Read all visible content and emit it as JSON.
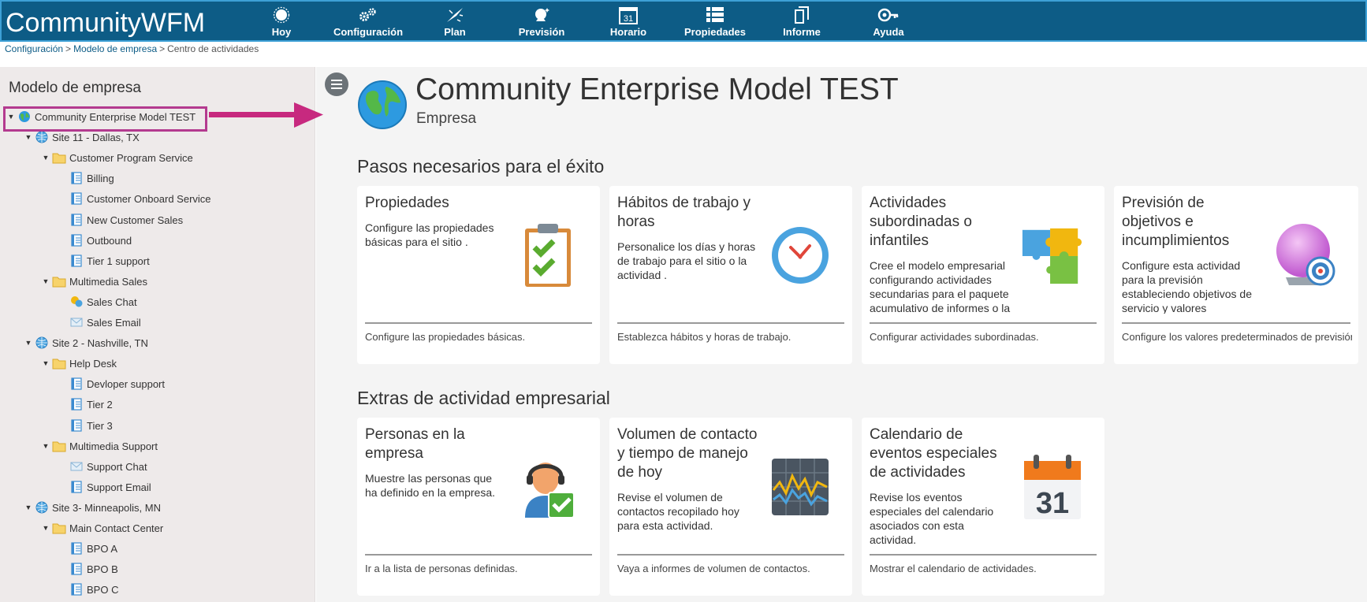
{
  "app": {
    "brand": "CommunityWFM"
  },
  "nav": [
    {
      "label": "Hoy",
      "icon": "sun-icon"
    },
    {
      "label": "Configuración",
      "icon": "gears-icon"
    },
    {
      "label": "Plan",
      "icon": "compass-icon"
    },
    {
      "label": "Previsión",
      "icon": "crystal-ball-icon"
    },
    {
      "label": "Horario",
      "icon": "calendar-icon"
    },
    {
      "label": "Propiedades",
      "icon": "list-icon"
    },
    {
      "label": "Informe",
      "icon": "document-icon"
    },
    {
      "label": "Ayuda",
      "icon": "help-key-icon"
    }
  ],
  "breadcrumb": {
    "item1": "Configuración",
    "item2": "Modelo de empresa",
    "current": "Centro de actividades",
    "separator": ">"
  },
  "sidebar": {
    "title": "Modelo de empresa",
    "tree": [
      {
        "label": "Community Enterprise Model TEST",
        "type": "globe",
        "level": 0,
        "expandable": true
      },
      {
        "label": "Site 11 - Dallas, TX",
        "type": "site",
        "level": 1,
        "expandable": true
      },
      {
        "label": "Customer Program Service",
        "type": "folder",
        "level": 2,
        "expandable": true
      },
      {
        "label": "Billing",
        "type": "activity",
        "level": 3,
        "expandable": false
      },
      {
        "label": "Customer Onboard Service",
        "type": "activity",
        "level": 3,
        "expandable": false
      },
      {
        "label": "New Customer Sales",
        "type": "activity",
        "level": 3,
        "expandable": false
      },
      {
        "label": "Outbound",
        "type": "activity",
        "level": 3,
        "expandable": false
      },
      {
        "label": "Tier 1 support",
        "type": "activity",
        "level": 3,
        "expandable": false
      },
      {
        "label": "Multimedia Sales",
        "type": "folder",
        "level": 2,
        "expandable": true
      },
      {
        "label": "Sales Chat",
        "type": "chat",
        "level": 3,
        "expandable": false
      },
      {
        "label": "Sales Email",
        "type": "email",
        "level": 3,
        "expandable": false
      },
      {
        "label": "Site 2 - Nashville, TN",
        "type": "site",
        "level": 1,
        "expandable": true
      },
      {
        "label": "Help Desk",
        "type": "folder",
        "level": 2,
        "expandable": true
      },
      {
        "label": "Devloper support",
        "type": "activity",
        "level": 3,
        "expandable": false
      },
      {
        "label": "Tier 2",
        "type": "activity",
        "level": 3,
        "expandable": false
      },
      {
        "label": "Tier 3",
        "type": "activity",
        "level": 3,
        "expandable": false
      },
      {
        "label": "Multimedia Support",
        "type": "folder",
        "level": 2,
        "expandable": true
      },
      {
        "label": "Support Chat",
        "type": "email",
        "level": 3,
        "expandable": false
      },
      {
        "label": "Support Email",
        "type": "activity",
        "level": 3,
        "expandable": false
      },
      {
        "label": "Site 3- Minneapolis, MN",
        "type": "site",
        "level": 1,
        "expandable": true
      },
      {
        "label": "Main Contact Center",
        "type": "folder",
        "level": 2,
        "expandable": true
      },
      {
        "label": "BPO A",
        "type": "activity",
        "level": 3,
        "expandable": false
      },
      {
        "label": "BPO B",
        "type": "activity",
        "level": 3,
        "expandable": false
      },
      {
        "label": "BPO C",
        "type": "activity",
        "level": 3,
        "expandable": false
      }
    ]
  },
  "header": {
    "title": "Community Enterprise Model TEST",
    "subtitle": "Empresa"
  },
  "sections": [
    {
      "title": "Pasos necesarios para el éxito",
      "cards": [
        {
          "title": "Propiedades",
          "desc": "Configure las propiedades básicas para el sitio .",
          "link": "Configure las propiedades básicas.",
          "icon": "clipboard-check-icon"
        },
        {
          "title": "Hábitos de trabajo y horas",
          "desc": "Personalice los días y horas de trabajo para el sitio o la actividad .",
          "link": "Establezca hábitos y horas de trabajo.",
          "icon": "clock-icon"
        },
        {
          "title": "Actividades subordinadas o infantiles",
          "desc": "Cree el modelo empresarial configurando actividades secundarias para el paquete acumulativo de informes o la consolidación de datos.",
          "link": "Configurar actividades subordinadas.",
          "icon": "puzzle-icon"
        },
        {
          "title": "Previsión de objetivos e incumplimientos",
          "desc": "Configure esta actividad para la previsión estableciendo objetivos de servicio y valores predeterminados de previsión.",
          "link": "Configure los valores predeterminados de previsión.",
          "icon": "crystal-ball-target-icon"
        }
      ]
    },
    {
      "title": "Extras de actividad empresarial",
      "cards": [
        {
          "title": "Personas en la empresa",
          "desc": "Muestre las personas que ha definido en la empresa.",
          "link": "Ir a la lista de personas definidas.",
          "icon": "agent-check-icon"
        },
        {
          "title": "Volumen de contacto y tiempo de manejo de hoy",
          "desc": "Revise el volumen de contactos recopilado hoy para esta actividad.",
          "link": "Vaya a informes de volumen de contactos.",
          "icon": "chart-grid-icon"
        },
        {
          "title": "Calendario de eventos especiales de actividades",
          "desc": "Revise los eventos especiales del calendario asociados con esta actividad.",
          "link": "Mostrar el calendario de actividades.",
          "icon": "calendar-31-icon"
        }
      ]
    }
  ],
  "calendar_icon_day": "31",
  "colors": {
    "topbar": "#0d5c86",
    "highlight": "#b43a8f",
    "arrow": "#c7297f"
  }
}
